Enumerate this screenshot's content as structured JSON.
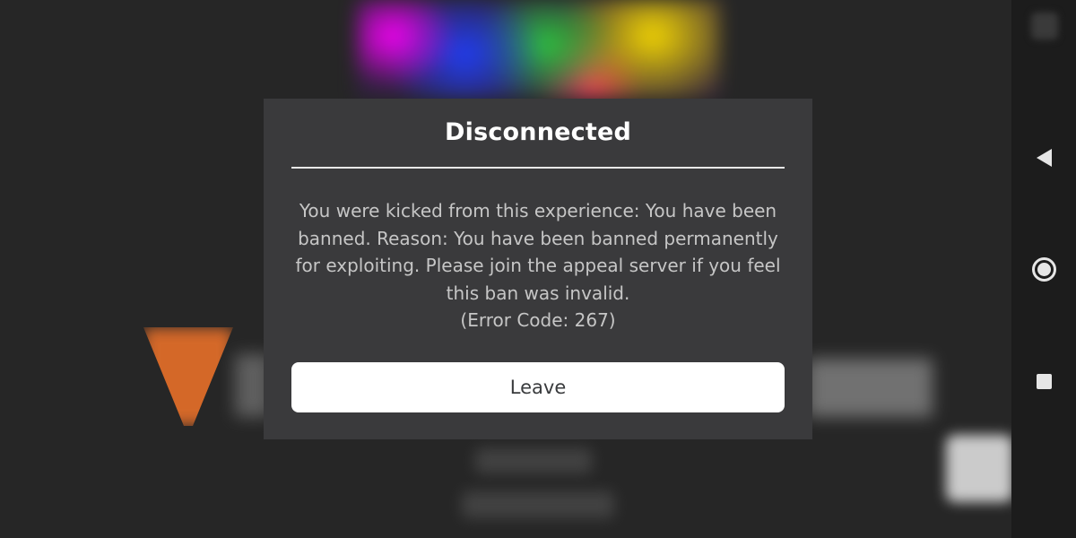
{
  "dialog": {
    "title": "Disconnected",
    "message": "You were kicked from this experience: You have been banned. Reason: You have been banned permanently for exploiting. Please join the appeal server if you feel this ban was invalid.",
    "error_code": "(Error Code: 267)",
    "leave_label": "Leave"
  },
  "nav_bar": {
    "icons": [
      "back-icon",
      "home-icon",
      "recent-apps-icon"
    ]
  },
  "colors": {
    "dialog_background": "#3a3a3c",
    "title_text": "#ffffff",
    "message_text": "#c6c6c6",
    "button_background": "#ffffff",
    "button_text": "#393b3d",
    "nav_bar_background": "#1c1c1c"
  }
}
